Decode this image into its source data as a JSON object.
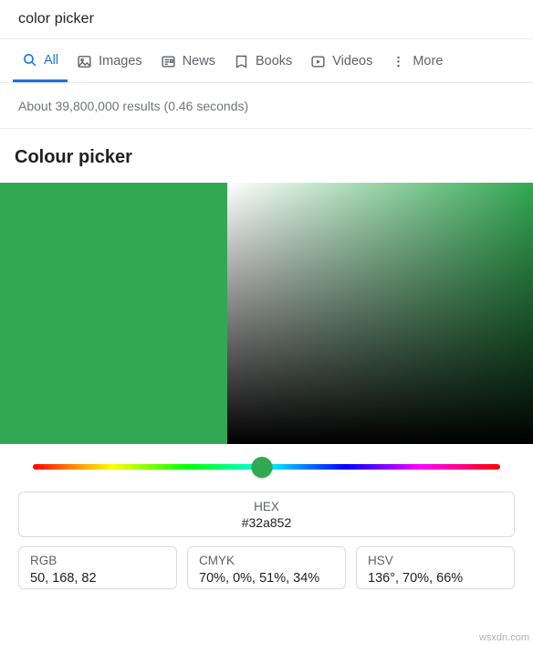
{
  "search": {
    "query": "color picker"
  },
  "tabs": [
    {
      "label": "All",
      "icon": "search-icon",
      "active": true
    },
    {
      "label": "Images",
      "icon": "image-icon",
      "active": false
    },
    {
      "label": "News",
      "icon": "news-icon",
      "active": false
    },
    {
      "label": "Books",
      "icon": "book-icon",
      "active": false
    },
    {
      "label": "Videos",
      "icon": "video-icon",
      "active": false
    },
    {
      "label": "More",
      "icon": "more-vertical-icon",
      "active": false
    }
  ],
  "result_stats": "About 39,800,000 results (0.46 seconds)",
  "picker": {
    "title": "Colour picker",
    "selected_color": "#32a852",
    "hue_position_percent": 49,
    "hex": {
      "label": "HEX",
      "value": "#32a852"
    },
    "values": [
      {
        "label": "RGB",
        "value": "50, 168, 82"
      },
      {
        "label": "CMYK",
        "value": "70%, 0%, 51%, 34%"
      },
      {
        "label": "HSV",
        "value": "136°, 70%, 66%"
      }
    ]
  },
  "watermark": "wsxdn.com"
}
